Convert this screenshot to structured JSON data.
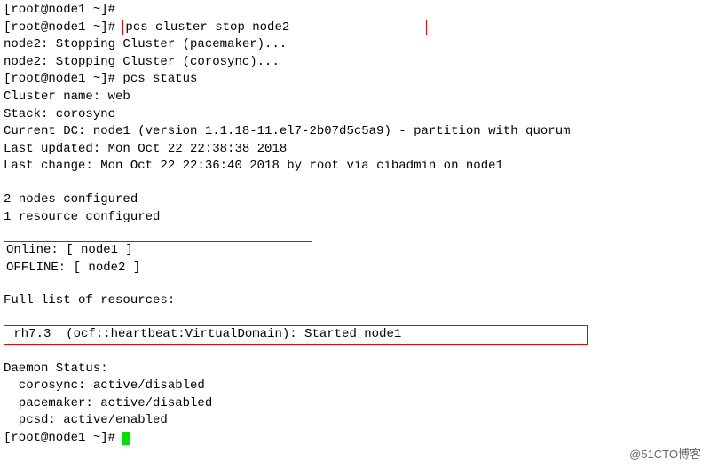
{
  "lines": {
    "l0": "[root@node1 ~]#",
    "prompt1": "[root@node1 ~]# ",
    "cmd1": "pcs cluster stop node2",
    "l2": "node2: Stopping Cluster (pacemaker)...",
    "l3": "node2: Stopping Cluster (corosync)...",
    "l4": "[root@node1 ~]# pcs status",
    "l5": "Cluster name: web",
    "l6": "Stack: corosync",
    "l7": "Current DC: node1 (version 1.1.18-11.el7-2b07d5c5a9) - partition with quorum",
    "l8": "Last updated: Mon Oct 22 22:38:38 2018",
    "l9": "Last change: Mon Oct 22 22:36:40 2018 by root via cibadmin on node1",
    "l10": "2 nodes configured",
    "l11": "1 resource configured",
    "online": "Online: [ node1 ]",
    "offline": "OFFLINE: [ node2 ]",
    "fulllist": "Full list of resources:",
    "resline": " rh7.3  (ocf::heartbeat:VirtualDomain): Started node1",
    "daemon": "Daemon Status:",
    "d1": "  corosync: active/disabled",
    "d2": "  pacemaker: active/disabled",
    "d3": "  pcsd: active/enabled",
    "promptend": "[root@node1 ~]# "
  },
  "watermark": "@51CTO博客"
}
